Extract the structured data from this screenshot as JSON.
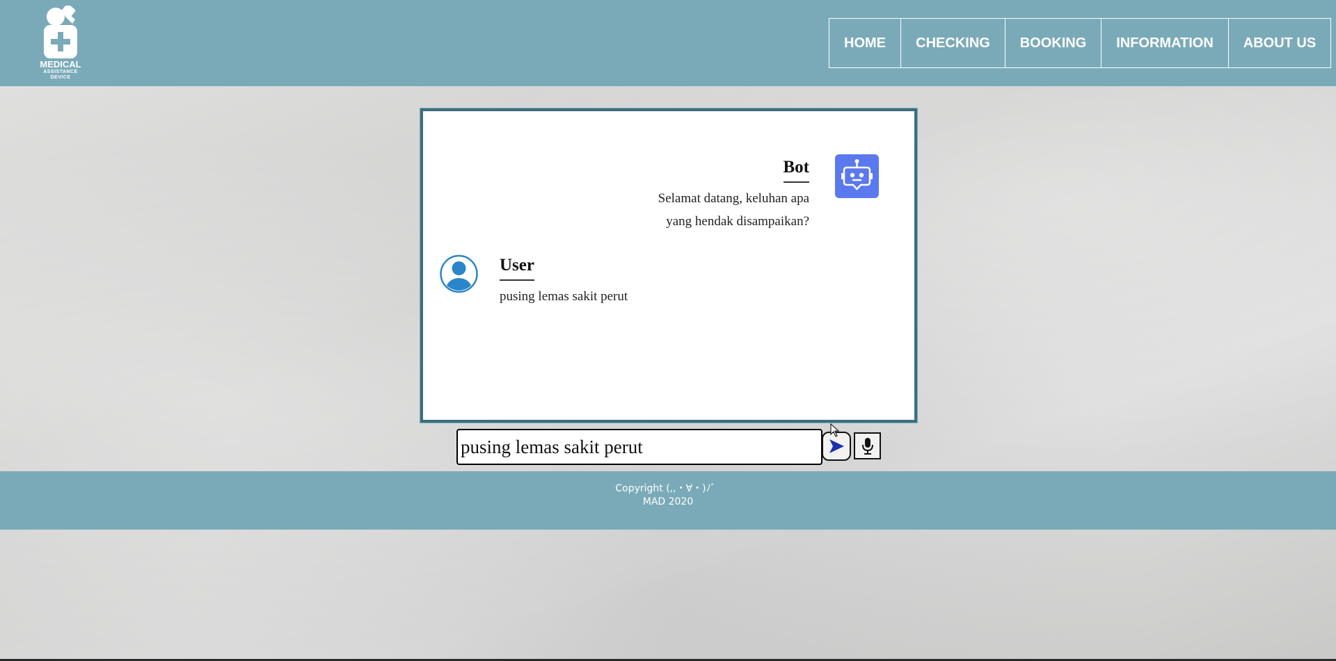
{
  "header": {
    "logo": {
      "line1": "MEDICAL",
      "line2": "ASSISTANCE",
      "line3": "DEVICE",
      "icon": "medical-person-icon"
    },
    "nav": [
      {
        "label": "HOME"
      },
      {
        "label": "CHECKING"
      },
      {
        "label": "BOOKING"
      },
      {
        "label": "INFORMATION"
      },
      {
        "label": "ABOUT US"
      }
    ]
  },
  "chat": {
    "messages": [
      {
        "sender": "Bot",
        "avatar": "robot-icon",
        "line1": "Selamat datang, keluhan apa",
        "line2": "yang hendak disampaikan?"
      },
      {
        "sender": "User",
        "avatar": "user-icon",
        "text": "pusing lemas sakit perut"
      }
    ],
    "input_value": "pusing lemas sakit perut",
    "send_icon": "send-arrow-icon",
    "mic_icon": "microphone-icon"
  },
  "footer": {
    "copyright": "Copyright (,,・∀・)ﾉ゛",
    "year_line": "MAD 2020"
  },
  "colors": {
    "header_bg": "#7aaab8",
    "chat_border": "#3c6e7d",
    "bot_avatar": "#5a79ee",
    "user_avatar": "#2a86c9"
  }
}
